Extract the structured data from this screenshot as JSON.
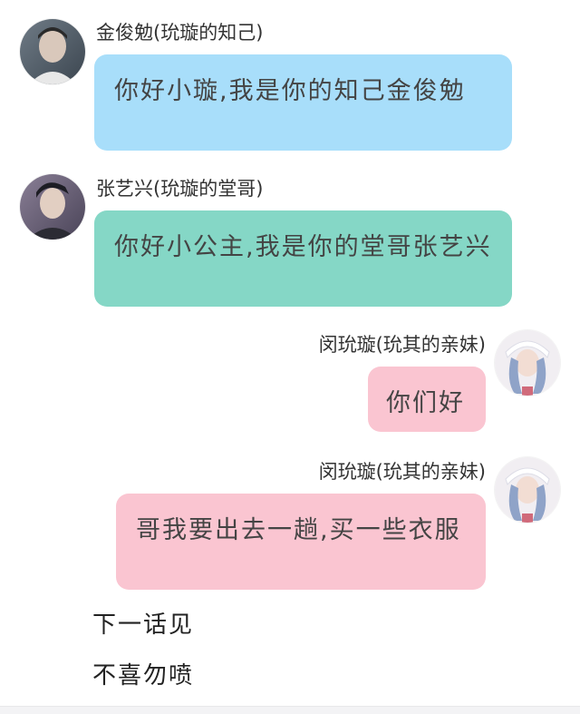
{
  "messages": [
    {
      "sender": "金俊勉(玧璇的知己)",
      "text": "你好小璇,我是你的知己金俊勉",
      "bubble_color": "#a8defa"
    },
    {
      "sender": "张艺兴(玧璇的堂哥)",
      "text": "你好小公主,我是你的堂哥张艺兴",
      "bubble_color": "#85d7c6"
    },
    {
      "sender": "闵玧璇(玧其的亲妹)",
      "text": "你们好",
      "bubble_color": "#fac5d1"
    },
    {
      "sender": "闵玧璇(玧其的亲妹)",
      "text": "哥我要出去一趟,买一些衣服",
      "bubble_color": "#fac5d1"
    }
  ],
  "footer": {
    "line1": "下一话见",
    "line2": "不喜勿喷"
  },
  "avatars": [
    "avatar-jin-junmian",
    "avatar-zhang-yixing",
    "avatar-min-yunxuan",
    "avatar-min-yunxuan"
  ]
}
